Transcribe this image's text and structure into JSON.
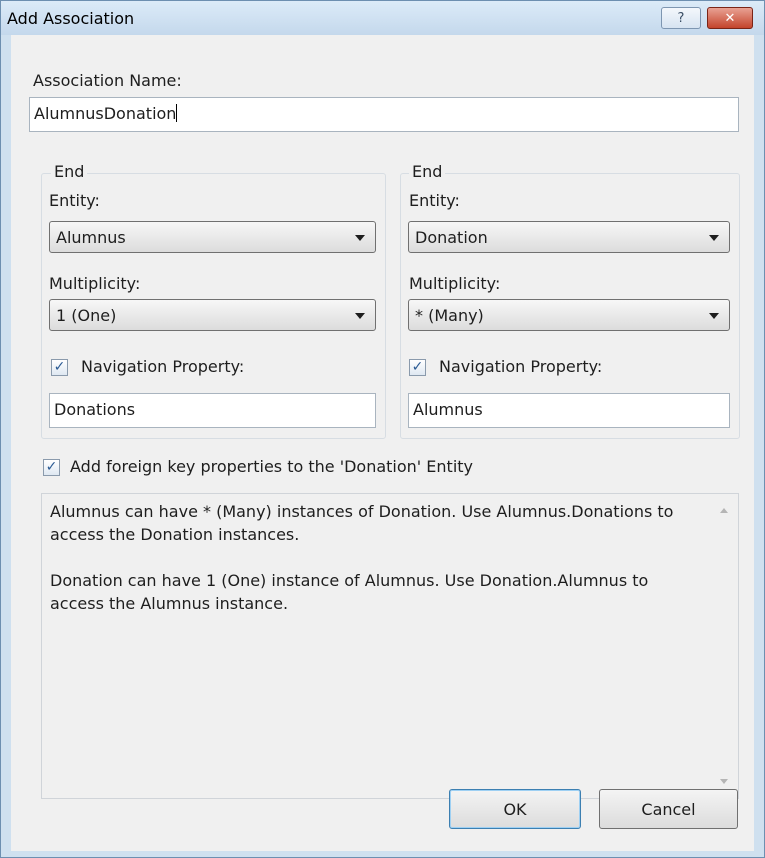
{
  "window": {
    "title": "Add Association",
    "help_glyph": "?",
    "close_glyph": "✕"
  },
  "association": {
    "label": "Association Name:",
    "value": "AlumnusDonation"
  },
  "end1": {
    "legend": "End",
    "entity_label": "Entity:",
    "entity_value": "Alumnus",
    "multiplicity_label": "Multiplicity:",
    "multiplicity_value": "1 (One)",
    "nav_checked": true,
    "nav_label": "Navigation Property:",
    "nav_value": "Donations"
  },
  "end2": {
    "legend": "End",
    "entity_label": "Entity:",
    "entity_value": "Donation",
    "multiplicity_label": "Multiplicity:",
    "multiplicity_value": "* (Many)",
    "nav_checked": true,
    "nav_label": "Navigation Property:",
    "nav_value": "Alumnus"
  },
  "foreign_key": {
    "checked": true,
    "label": "Add foreign key properties to the 'Donation' Entity"
  },
  "description": {
    "line1": "Alumnus can have * (Many) instances of Donation. Use Alumnus.Donations to access the Donation instances.",
    "line2": "Donation can have 1 (One) instance of Alumnus. Use Donation.Alumnus to access the Alumnus instance."
  },
  "buttons": {
    "ok": "OK",
    "cancel": "Cancel"
  },
  "check_glyph": "✓"
}
